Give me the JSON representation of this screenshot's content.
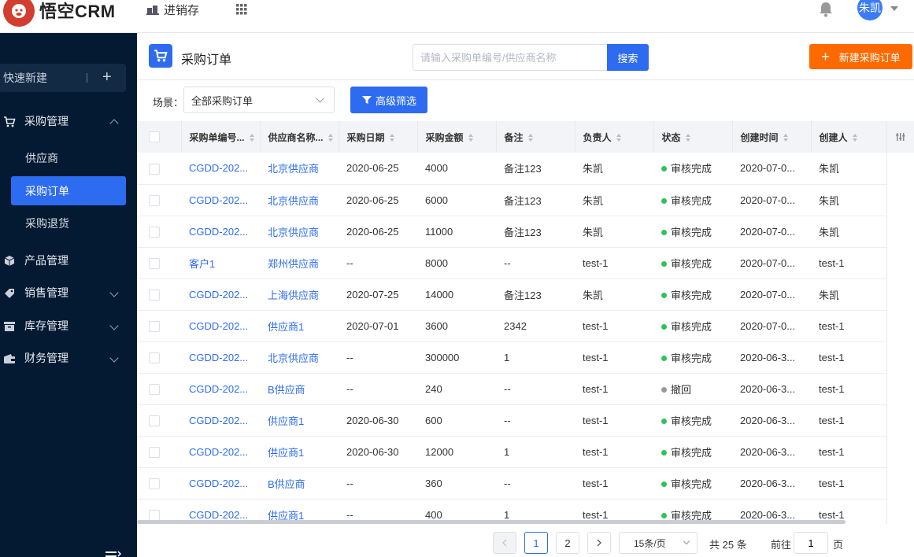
{
  "app": {
    "logo_text": "悟空CRM",
    "module": "进销存"
  },
  "user": {
    "avatar_text": "朱凯"
  },
  "colors": {
    "primary": "#2d6cf0",
    "sidebar_bg": "#041a33",
    "accent_orange": "#ff6a00",
    "status_green": "#2fc25b",
    "status_gray": "#999999"
  },
  "sidebar": {
    "quick_new": "快速新建",
    "groups": [
      {
        "label": "采购管理",
        "icon": "cart-icon",
        "expanded": true
      },
      {
        "label": "产品管理",
        "icon": "cube-icon"
      },
      {
        "label": "销售管理",
        "icon": "tag-icon"
      },
      {
        "label": "库存管理",
        "icon": "warehouse-icon"
      },
      {
        "label": "财务管理",
        "icon": "wallet-icon"
      }
    ],
    "sub_items": [
      {
        "label": "供应商"
      },
      {
        "label": "采购订单",
        "active": true
      },
      {
        "label": "采购退货"
      }
    ]
  },
  "page": {
    "title": "采购订单",
    "search_placeholder": "请输入采购单编号/供应商名称",
    "search_button": "搜索",
    "new_button": "新建采购订单"
  },
  "filter": {
    "scene_label": "场景：",
    "scene_value": "全部采购订单",
    "advanced_button": "高级筛选"
  },
  "table": {
    "columns": [
      "采购单编号...",
      "供应商名称...",
      "采购日期",
      "采购金额",
      "备注",
      "负责人",
      "状态",
      "创建时间",
      "创建人"
    ],
    "rows": [
      [
        "CGDD-202...",
        "北京供应商",
        "2020-06-25",
        "4000",
        "备注123",
        "朱凯",
        "审核完成",
        "2020-07-0...",
        "朱凯"
      ],
      [
        "CGDD-202...",
        "北京供应商",
        "2020-06-25",
        "6000",
        "备注123",
        "朱凯",
        "审核完成",
        "2020-07-0...",
        "朱凯"
      ],
      [
        "CGDD-202...",
        "北京供应商",
        "2020-06-25",
        "11000",
        "备注123",
        "朱凯",
        "审核完成",
        "2020-07-0...",
        "朱凯"
      ],
      [
        "客户1",
        "郑州供应商",
        "--",
        "8000",
        "--",
        "test-1",
        "审核完成",
        "2020-07-0...",
        "test-1"
      ],
      [
        "CGDD-202...",
        "上海供应商",
        "2020-07-25",
        "14000",
        "备注123",
        "朱凯",
        "审核完成",
        "2020-07-0...",
        "朱凯"
      ],
      [
        "CGDD-202...",
        "供应商1",
        "2020-07-01",
        "3600",
        "2342",
        "test-1",
        "审核完成",
        "2020-07-0...",
        "test-1"
      ],
      [
        "CGDD-202...",
        "北京供应商",
        "--",
        "300000",
        "1",
        "test-1",
        "审核完成",
        "2020-06-3...",
        "test-1"
      ],
      [
        "CGDD-202...",
        "B供应商",
        "--",
        "240",
        "--",
        "test-1",
        "撤回",
        "2020-06-3...",
        "test-1"
      ],
      [
        "CGDD-202...",
        "供应商1",
        "2020-06-30",
        "600",
        "--",
        "test-1",
        "审核完成",
        "2020-06-3...",
        "test-1"
      ],
      [
        "CGDD-202...",
        "供应商1",
        "2020-06-30",
        "12000",
        "1",
        "test-1",
        "审核完成",
        "2020-06-3...",
        "test-1"
      ],
      [
        "CGDD-202...",
        "B供应商",
        "--",
        "360",
        "--",
        "test-1",
        "审核完成",
        "2020-06-3...",
        "test-1"
      ],
      [
        "CGDD-202...",
        "供应商1",
        "--",
        "400",
        "1",
        "test-1",
        "审核完成",
        "2020-06-3...",
        "test-1"
      ]
    ]
  },
  "pagination": {
    "pages": [
      "1",
      "2"
    ],
    "current": "1",
    "page_size": "15条/页",
    "total": "共 25 条",
    "goto_label": "前往",
    "goto_value": "1",
    "goto_unit": "页"
  }
}
